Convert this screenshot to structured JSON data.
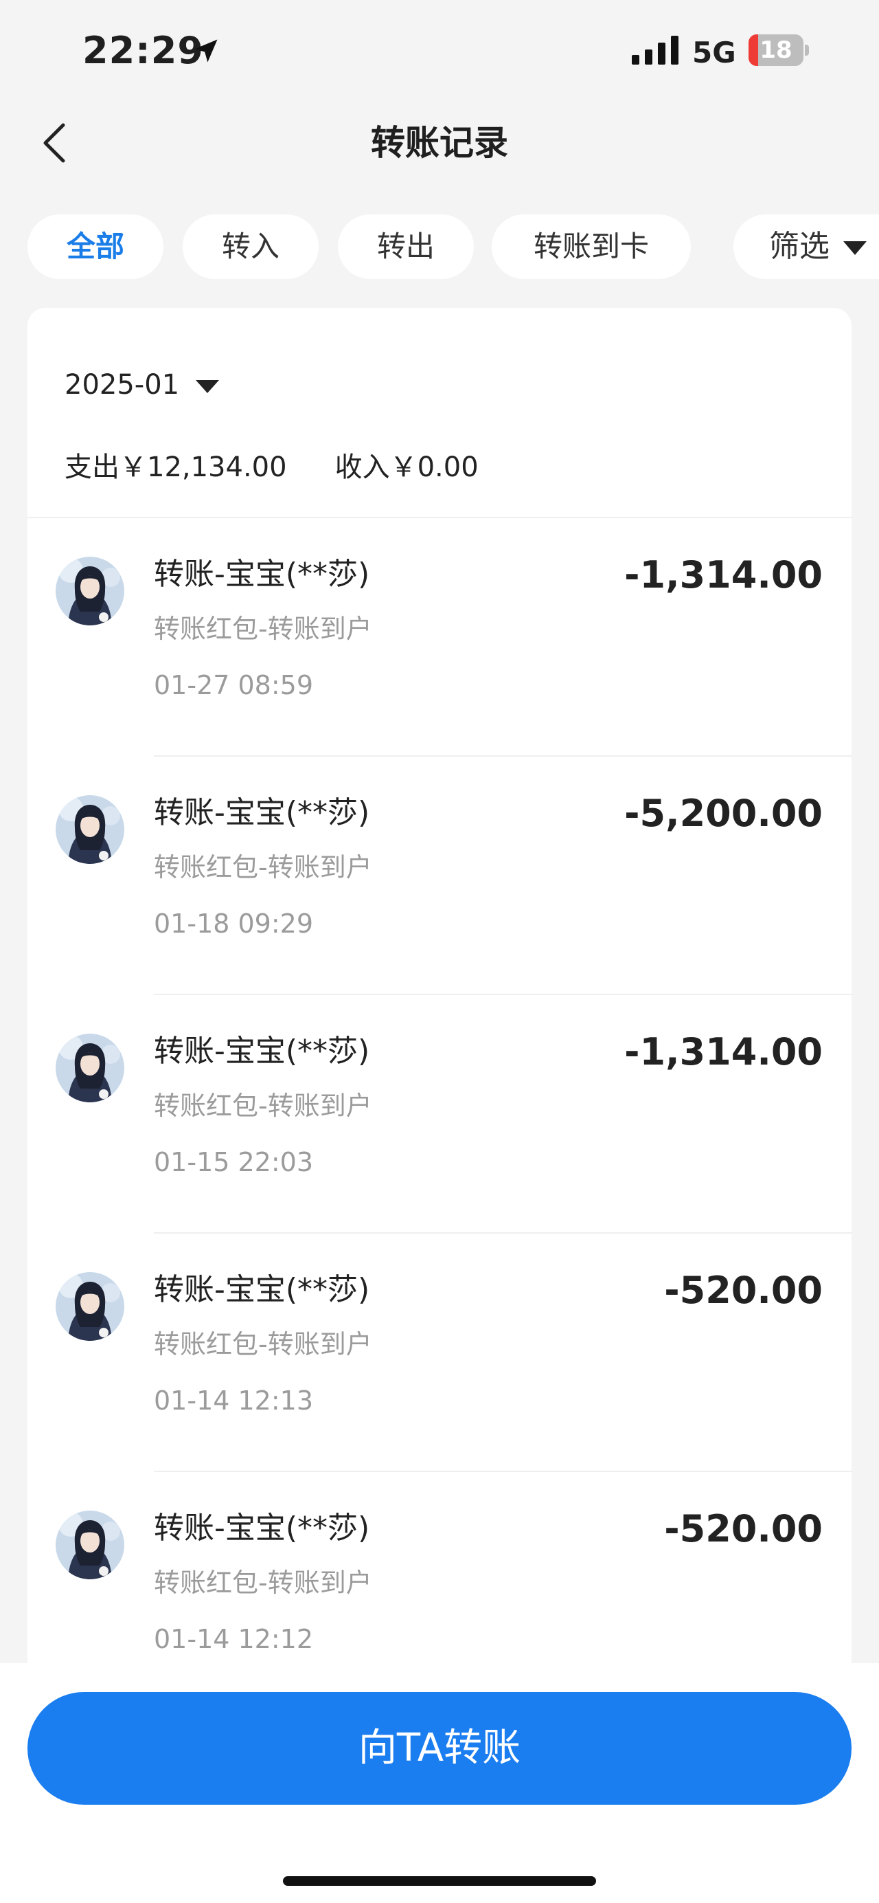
{
  "status_bar": {
    "time": "22:29",
    "network": "5G",
    "battery": "18",
    "battery_level": 0.18
  },
  "nav": {
    "title": "转账记录"
  },
  "tabs": [
    {
      "label": "全部",
      "active": true
    },
    {
      "label": "转入",
      "active": false
    },
    {
      "label": "转出",
      "active": false
    },
    {
      "label": "转账到卡",
      "active": false
    }
  ],
  "filter": {
    "label": "筛选"
  },
  "summary": {
    "month": "2025-01",
    "expense": "支出￥12,134.00",
    "income": "收入￥0.00"
  },
  "transactions": [
    {
      "title": "转账-宝宝(**莎)",
      "subtitle": "转账红包-转账到户",
      "time": "01-27 08:59",
      "amount": "-1,314.00"
    },
    {
      "title": "转账-宝宝(**莎)",
      "subtitle": "转账红包-转账到户",
      "time": "01-18 09:29",
      "amount": "-5,200.00"
    },
    {
      "title": "转账-宝宝(**莎)",
      "subtitle": "转账红包-转账到户",
      "time": "01-15 22:03",
      "amount": "-1,314.00"
    },
    {
      "title": "转账-宝宝(**莎)",
      "subtitle": "转账红包-转账到户",
      "time": "01-14 12:13",
      "amount": "-520.00"
    },
    {
      "title": "转账-宝宝(**莎)",
      "subtitle": "转账红包-转账到户",
      "time": "01-14 12:12",
      "amount": "-520.00"
    }
  ],
  "action": {
    "label": "向TA转账"
  },
  "colors": {
    "accent": "#1a7df0",
    "active_tab": "#1b7ee8",
    "battery_low": "#ee3b36"
  }
}
